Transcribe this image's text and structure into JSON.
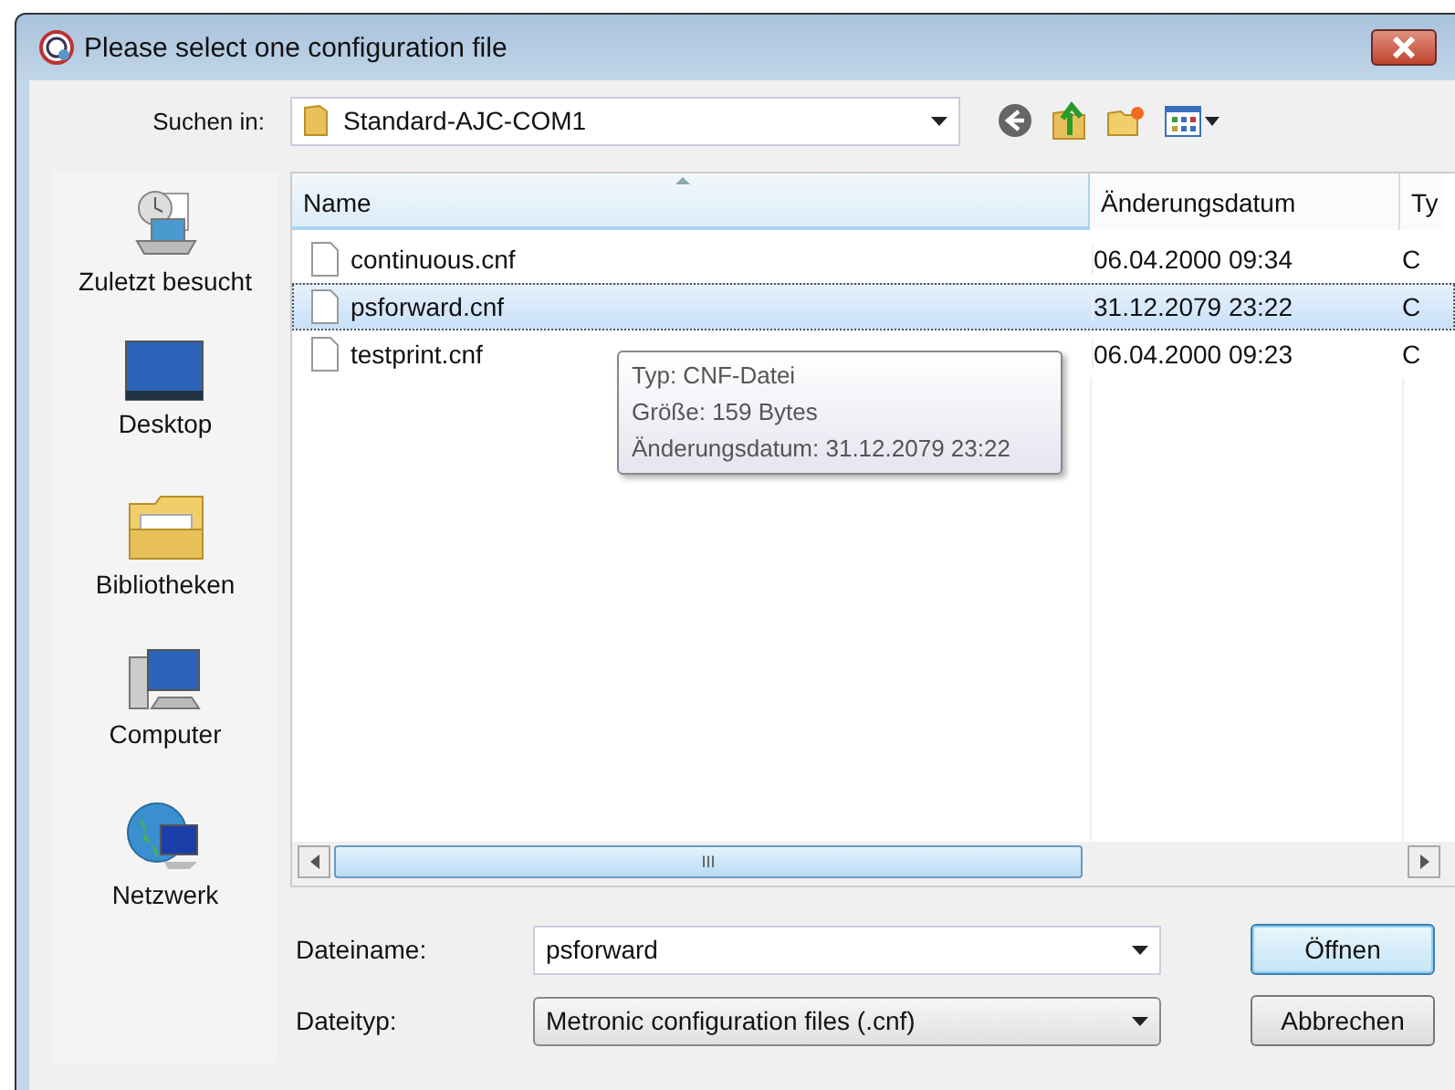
{
  "window": {
    "title": "Please select one configuration file"
  },
  "toolbar": {
    "look_in_label": "Suchen in:",
    "folder": "Standard-AJC-COM1"
  },
  "sidebar": {
    "items": [
      {
        "label": "Zuletzt besucht",
        "kind": "recent"
      },
      {
        "label": "Desktop",
        "kind": "desktop"
      },
      {
        "label": "Bibliotheken",
        "kind": "libraries"
      },
      {
        "label": "Computer",
        "kind": "computer"
      },
      {
        "label": "Netzwerk",
        "kind": "network"
      }
    ]
  },
  "table": {
    "columns": [
      "Name",
      "Änderungsdatum",
      "Ty"
    ],
    "rows": [
      {
        "name": "continuous.cnf",
        "date": "06.04.2000 09:34",
        "type": "C",
        "selected": false
      },
      {
        "name": "psforward.cnf",
        "date": "31.12.2079 23:22",
        "type": "C",
        "selected": true
      },
      {
        "name": "testprint.cnf",
        "date": "06.04.2000 09:23",
        "type": "C",
        "selected": false
      }
    ]
  },
  "tooltip": {
    "lines": [
      "Typ: CNF-Datei",
      "Größe: 159 Bytes",
      "Änderungsdatum: 31.12.2079 23:22"
    ]
  },
  "scrollbar_label": "III",
  "filename": {
    "label": "Dateiname:",
    "value": "psforward"
  },
  "filetype": {
    "label": "Dateityp:",
    "value": "Metronic configuration files (.cnf)"
  },
  "buttons": [
    "Öffnen",
    "Abbrechen"
  ]
}
